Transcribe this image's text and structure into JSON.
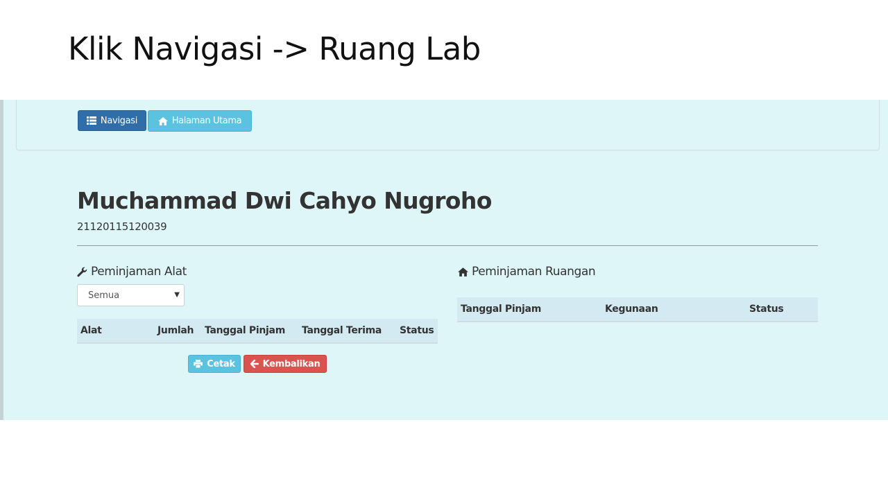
{
  "slide": {
    "title": "Klik Navigasi -> Ruang Lab"
  },
  "navbar": {
    "navigasi_label": "Navigasi",
    "home_label": "Halaman Utama"
  },
  "profile": {
    "name": "Muchammad Dwi Cahyo Nugroho",
    "nim": "21120115120039"
  },
  "peminjaman_alat": {
    "title": "Peminjaman Alat",
    "filter_selected": "Semua",
    "columns": [
      "Alat",
      "Jumlah",
      "Tanggal Pinjam",
      "Tanggal Terima",
      "Status"
    ],
    "rows": [],
    "cetak_label": "Cetak",
    "kembalikan_label": "Kembalikan"
  },
  "peminjaman_ruangan": {
    "title": "Peminjaman Ruangan",
    "columns": [
      "Tanggal Pinjam",
      "Kegunaan",
      "Status"
    ],
    "rows": []
  },
  "colors": {
    "page_bg": "#dff6f9",
    "primary": "#2f6ea8",
    "info": "#5bc2e0",
    "danger": "#d9534f",
    "table_header": "#d4eaf3"
  }
}
